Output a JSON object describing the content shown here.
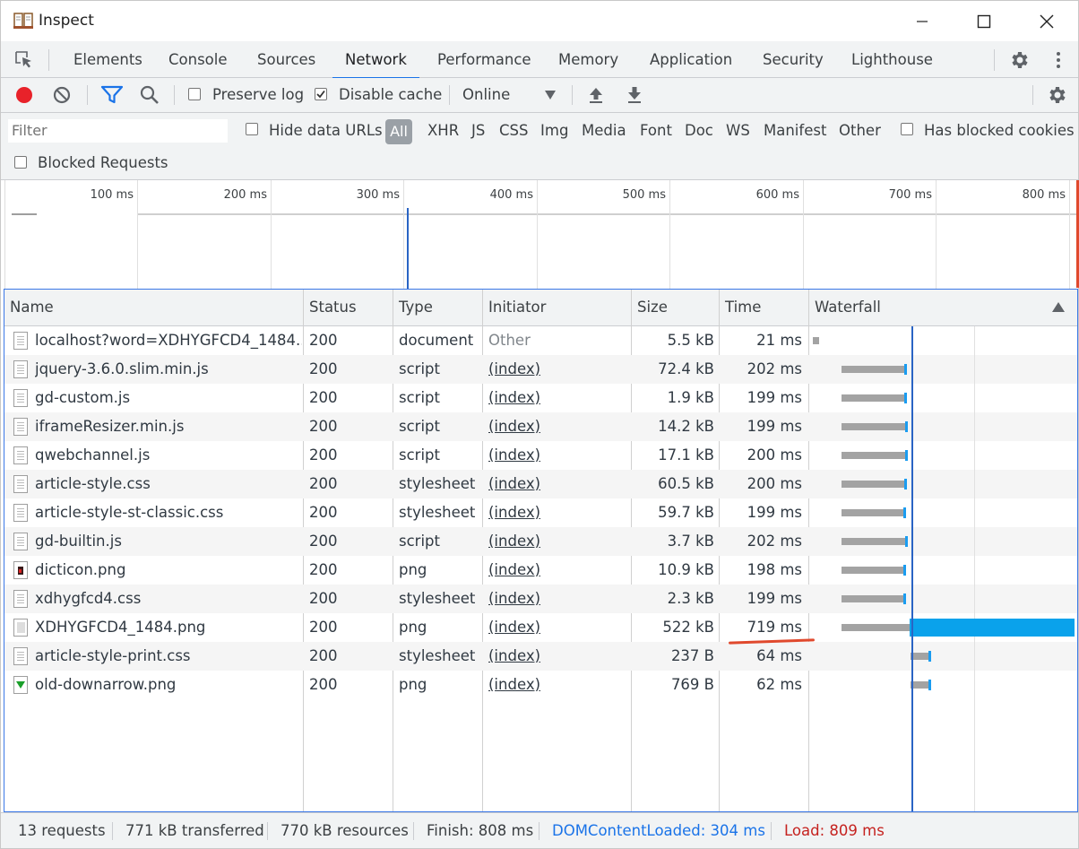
{
  "window": {
    "title": "Inspect"
  },
  "tabs": [
    "Elements",
    "Console",
    "Sources",
    "Network",
    "Performance",
    "Memory",
    "Application",
    "Security",
    "Lighthouse"
  ],
  "active_tab": "Network",
  "toolbar": {
    "preserve_log": "Preserve log",
    "disable_cache": "Disable cache",
    "throttling": "Online"
  },
  "filter": {
    "placeholder": "Filter",
    "hide_data_urls": "Hide data URLs",
    "types": [
      "All",
      "XHR",
      "JS",
      "CSS",
      "Img",
      "Media",
      "Font",
      "Doc",
      "WS",
      "Manifest",
      "Other"
    ],
    "has_blocked_cookies": "Has blocked cookies",
    "blocked_requests": "Blocked Requests"
  },
  "overview": {
    "ticks": [
      "100 ms",
      "200 ms",
      "300 ms",
      "400 ms",
      "500 ms",
      "600 ms",
      "700 ms",
      "800 ms"
    ]
  },
  "columns": [
    "Name",
    "Status",
    "Type",
    "Initiator",
    "Size",
    "Time",
    "Waterfall"
  ],
  "requests": [
    {
      "name": "localhost?word=XDHYGFCD4_1484...",
      "status": "200",
      "type": "document",
      "initiator": "Other",
      "size": "5.5 kB",
      "time": "21 ms",
      "icon": "doc"
    },
    {
      "name": "jquery-3.6.0.slim.min.js",
      "status": "200",
      "type": "script",
      "initiator": "(index)",
      "size": "72.4 kB",
      "time": "202 ms",
      "icon": "doc"
    },
    {
      "name": "gd-custom.js",
      "status": "200",
      "type": "script",
      "initiator": "(index)",
      "size": "1.9 kB",
      "time": "199 ms",
      "icon": "doc"
    },
    {
      "name": "iframeResizer.min.js",
      "status": "200",
      "type": "script",
      "initiator": "(index)",
      "size": "14.2 kB",
      "time": "199 ms",
      "icon": "doc"
    },
    {
      "name": "qwebchannel.js",
      "status": "200",
      "type": "script",
      "initiator": "(index)",
      "size": "17.1 kB",
      "time": "200 ms",
      "icon": "doc"
    },
    {
      "name": "article-style.css",
      "status": "200",
      "type": "stylesheet",
      "initiator": "(index)",
      "size": "60.5 kB",
      "time": "200 ms",
      "icon": "doc"
    },
    {
      "name": "article-style-st-classic.css",
      "status": "200",
      "type": "stylesheet",
      "initiator": "(index)",
      "size": "59.7 kB",
      "time": "199 ms",
      "icon": "doc"
    },
    {
      "name": "gd-builtin.js",
      "status": "200",
      "type": "script",
      "initiator": "(index)",
      "size": "3.7 kB",
      "time": "202 ms",
      "icon": "doc"
    },
    {
      "name": "dicticon.png",
      "status": "200",
      "type": "png",
      "initiator": "(index)",
      "size": "10.9 kB",
      "time": "198 ms",
      "icon": "img-dark"
    },
    {
      "name": "xdhygfcd4.css",
      "status": "200",
      "type": "stylesheet",
      "initiator": "(index)",
      "size": "2.3 kB",
      "time": "199 ms",
      "icon": "doc"
    },
    {
      "name": "XDHYGFCD4_1484.png",
      "status": "200",
      "type": "png",
      "initiator": "(index)",
      "size": "522 kB",
      "time": "719 ms",
      "icon": "img-gray"
    },
    {
      "name": "article-style-print.css",
      "status": "200",
      "type": "stylesheet",
      "initiator": "(index)",
      "size": "237 B",
      "time": "64 ms",
      "icon": "doc"
    },
    {
      "name": "old-downarrow.png",
      "status": "200",
      "type": "png",
      "initiator": "(index)",
      "size": "769 B",
      "time": "62 ms",
      "icon": "img-green"
    }
  ],
  "statusbar": {
    "requests": "13 requests",
    "transferred": "771 kB transferred",
    "resources": "770 kB resources",
    "finish": "Finish: 808 ms",
    "dcl": "DOMContentLoaded: 304 ms",
    "load": "Load: 809 ms"
  },
  "colors": {
    "accent": "#1a73e8",
    "record": "#e8222a",
    "waterfall_receive": "#0aa2eb",
    "load": "#c5221f"
  }
}
